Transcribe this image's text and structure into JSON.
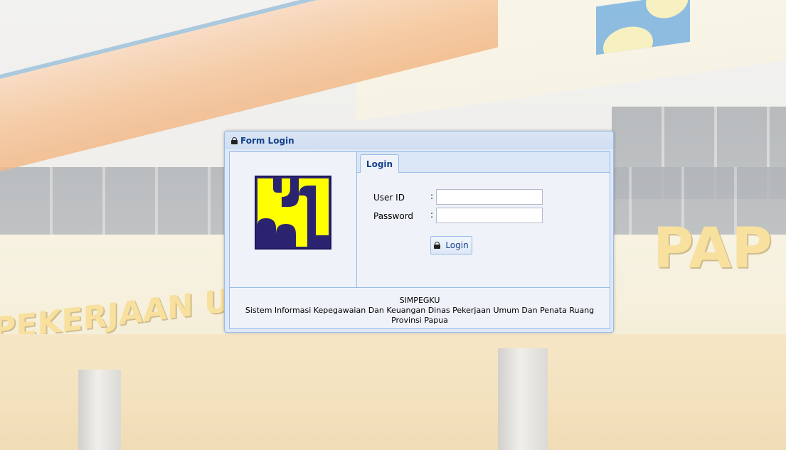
{
  "background": {
    "building_sign_left": "PEKERJAAN U",
    "building_sign_right": "PAP"
  },
  "dialog": {
    "title": "Form Login",
    "title_icon": "lock-icon"
  },
  "logo": {
    "name": "pu-logo",
    "colors": {
      "field": "#ffff00",
      "border": "#2a2470"
    }
  },
  "tabs": [
    {
      "label": "Login",
      "active": true
    }
  ],
  "form": {
    "user_id_label": "User ID",
    "password_label": "Password",
    "colon": ":",
    "user_id_value": "",
    "password_value": "",
    "login_button_label": "Login",
    "login_button_icon": "lock-icon"
  },
  "footer": {
    "app_name": "SIMPEGKU",
    "description": "Sistem Informasi Kepegawaian Dan Keuangan Dinas Pekerjaan Umum Dan Penata Ruang Provinsi Papua"
  },
  "colors": {
    "header_text": "#15428b",
    "panel_border": "#99bbe8",
    "panel_bg": "#eff3f9"
  }
}
